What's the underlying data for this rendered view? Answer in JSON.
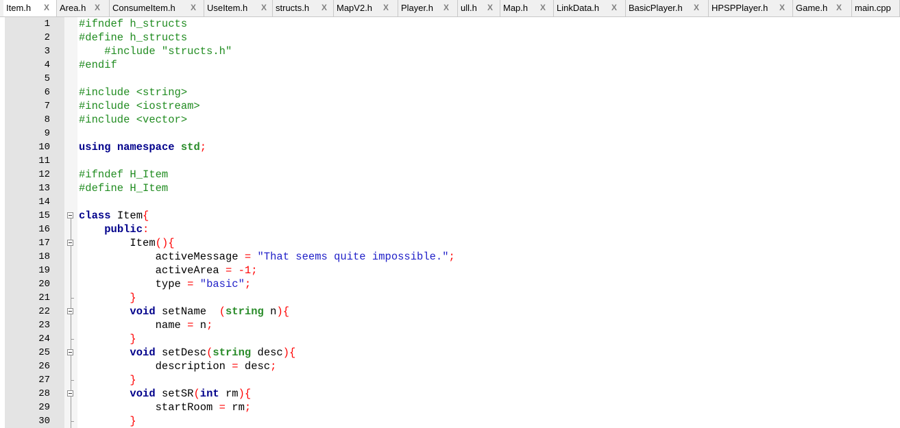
{
  "tabs": [
    {
      "label": "Item.h",
      "active": true
    },
    {
      "label": "Area.h"
    },
    {
      "label": "ConsumeItem.h"
    },
    {
      "label": "UseItem.h"
    },
    {
      "label": "structs.h"
    },
    {
      "label": "MapV2.h"
    },
    {
      "label": "Player.h"
    },
    {
      "label": "ull.h"
    },
    {
      "label": "Map.h"
    },
    {
      "label": "LinkData.h"
    },
    {
      "label": "BasicPlayer.h"
    },
    {
      "label": "HPSPPlayer.h"
    },
    {
      "label": "Game.h"
    },
    {
      "label": "main.cpp"
    }
  ],
  "close_glyph": "X",
  "line_numbers": [
    "1",
    "2",
    "3",
    "4",
    "5",
    "6",
    "7",
    "8",
    "9",
    "10",
    "11",
    "12",
    "13",
    "14",
    "15",
    "16",
    "17",
    "18",
    "19",
    "20",
    "21",
    "22",
    "23",
    "24",
    "25",
    "26",
    "27",
    "28",
    "29",
    "30"
  ],
  "code_lines": [
    [
      [
        "pre",
        "#ifndef h_structs"
      ]
    ],
    [
      [
        "pre",
        "#define h_structs"
      ]
    ],
    [
      [
        "sp",
        "    "
      ],
      [
        "pre",
        "#include \"structs.h\""
      ]
    ],
    [
      [
        "pre",
        "#endif"
      ]
    ],
    [],
    [
      [
        "pre",
        "#include <string>"
      ]
    ],
    [
      [
        "pre",
        "#include <iostream>"
      ]
    ],
    [
      [
        "pre",
        "#include <vector>"
      ]
    ],
    [],
    [
      [
        "kw",
        "using"
      ],
      [
        "sp",
        " "
      ],
      [
        "kw",
        "namespace"
      ],
      [
        "sp",
        " "
      ],
      [
        "type",
        "std"
      ],
      [
        "op",
        ";"
      ]
    ],
    [],
    [
      [
        "pre",
        "#ifndef H_Item"
      ]
    ],
    [
      [
        "pre",
        "#define H_Item"
      ]
    ],
    [],
    [
      [
        "kw",
        "class"
      ],
      [
        "sp",
        " "
      ],
      [
        "id",
        "Item"
      ],
      [
        "op",
        "{"
      ]
    ],
    [
      [
        "sp",
        "    "
      ],
      [
        "kw",
        "public"
      ],
      [
        "op",
        ":"
      ]
    ],
    [
      [
        "sp",
        "        "
      ],
      [
        "id",
        "Item"
      ],
      [
        "op",
        "(){"
      ]
    ],
    [
      [
        "sp",
        "            "
      ],
      [
        "id",
        "activeMessage"
      ],
      [
        "sp",
        " "
      ],
      [
        "op",
        "="
      ],
      [
        "sp",
        " "
      ],
      [
        "str",
        "\"That seems quite impossible.\""
      ],
      [
        "op",
        ";"
      ]
    ],
    [
      [
        "sp",
        "            "
      ],
      [
        "id",
        "activeArea"
      ],
      [
        "sp",
        " "
      ],
      [
        "op",
        "="
      ],
      [
        "sp",
        " "
      ],
      [
        "num",
        "-1"
      ],
      [
        "op",
        ";"
      ]
    ],
    [
      [
        "sp",
        "            "
      ],
      [
        "id",
        "type"
      ],
      [
        "sp",
        " "
      ],
      [
        "op",
        "="
      ],
      [
        "sp",
        " "
      ],
      [
        "str",
        "\"basic\""
      ],
      [
        "op",
        ";"
      ]
    ],
    [
      [
        "sp",
        "        "
      ],
      [
        "op",
        "}"
      ]
    ],
    [
      [
        "sp",
        "        "
      ],
      [
        "kw",
        "void"
      ],
      [
        "sp",
        " "
      ],
      [
        "id",
        "setName"
      ],
      [
        "sp",
        "  "
      ],
      [
        "op",
        "("
      ],
      [
        "type",
        "string"
      ],
      [
        "sp",
        " "
      ],
      [
        "id",
        "n"
      ],
      [
        "op",
        "){"
      ]
    ],
    [
      [
        "sp",
        "            "
      ],
      [
        "id",
        "name"
      ],
      [
        "sp",
        " "
      ],
      [
        "op",
        "="
      ],
      [
        "sp",
        " "
      ],
      [
        "id",
        "n"
      ],
      [
        "op",
        ";"
      ]
    ],
    [
      [
        "sp",
        "        "
      ],
      [
        "op",
        "}"
      ]
    ],
    [
      [
        "sp",
        "        "
      ],
      [
        "kw",
        "void"
      ],
      [
        "sp",
        " "
      ],
      [
        "id",
        "setDesc"
      ],
      [
        "op",
        "("
      ],
      [
        "type",
        "string"
      ],
      [
        "sp",
        " "
      ],
      [
        "id",
        "desc"
      ],
      [
        "op",
        "){"
      ]
    ],
    [
      [
        "sp",
        "            "
      ],
      [
        "id",
        "description"
      ],
      [
        "sp",
        " "
      ],
      [
        "op",
        "="
      ],
      [
        "sp",
        " "
      ],
      [
        "id",
        "desc"
      ],
      [
        "op",
        ";"
      ]
    ],
    [
      [
        "sp",
        "        "
      ],
      [
        "op",
        "}"
      ]
    ],
    [
      [
        "sp",
        "        "
      ],
      [
        "kw",
        "void"
      ],
      [
        "sp",
        " "
      ],
      [
        "id",
        "setSR"
      ],
      [
        "op",
        "("
      ],
      [
        "kw",
        "int"
      ],
      [
        "sp",
        " "
      ],
      [
        "id",
        "rm"
      ],
      [
        "op",
        "){"
      ]
    ],
    [
      [
        "sp",
        "            "
      ],
      [
        "id",
        "startRoom"
      ],
      [
        "sp",
        " "
      ],
      [
        "op",
        "="
      ],
      [
        "sp",
        " "
      ],
      [
        "id",
        "rm"
      ],
      [
        "op",
        ";"
      ]
    ],
    [
      [
        "sp",
        "        "
      ],
      [
        "op",
        "}"
      ]
    ]
  ],
  "colors": {
    "preprocessor": "#218c21",
    "keyword": "#00008b",
    "type": "#2a8c2a",
    "operator": "#ff0000",
    "string": "#2020c8",
    "number": "#ff0000",
    "gutter": "#e4e4e4"
  },
  "fold_markers": [
    "fold-open-icon",
    "fold-open-icon",
    "fold-open-icon",
    "fold-open-icon",
    "fold-open-icon"
  ]
}
